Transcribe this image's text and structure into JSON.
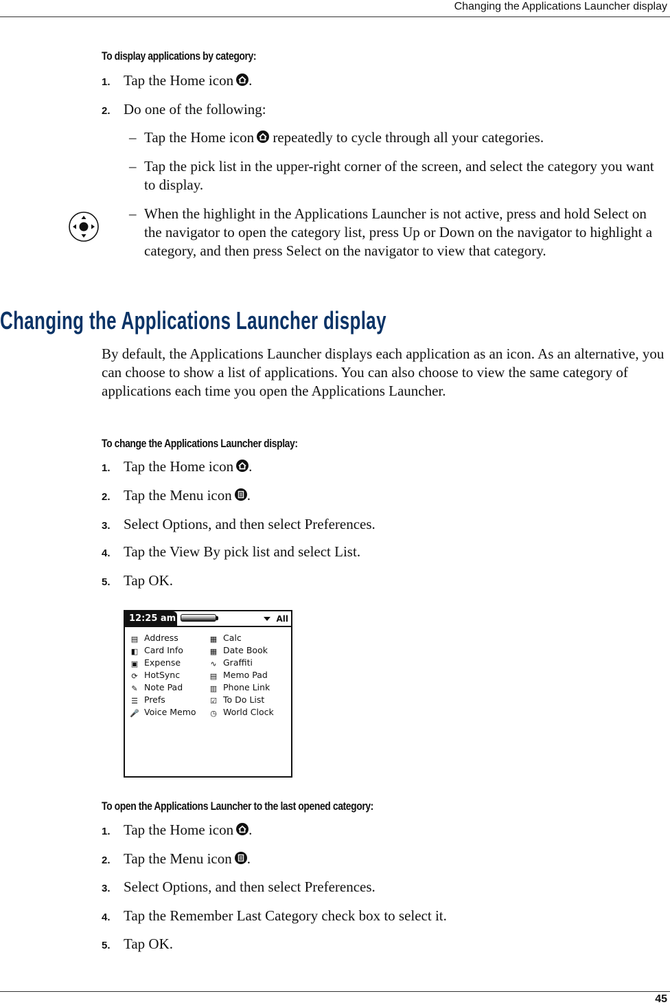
{
  "header": {
    "running_title": "Changing the Applications Launcher display"
  },
  "footer": {
    "page_number": "45"
  },
  "section1": {
    "heading": "To display applications by category:",
    "steps": [
      {
        "num": "1.",
        "text": "Tap the Home icon",
        "icon": "home-icon",
        "after": "."
      },
      {
        "num": "2.",
        "text": "Do one of the following:"
      }
    ],
    "options": [
      {
        "dash": "–",
        "text_before": "Tap the Home icon",
        "icon": "home-icon",
        "text_after": "repeatedly to cycle through all your categories."
      },
      {
        "dash": "–",
        "text": "Tap the pick list in the upper-right corner of the screen, and select the category you want to display."
      },
      {
        "dash": "–",
        "icon": "five-way-navigator-icon",
        "text": "When the highlight in the Applications Launcher is not active, press and hold Select on the navigator to open the category list, press Up or Down on the navigator to highlight a category, and then press Select on the navigator to view that category."
      }
    ]
  },
  "section2": {
    "title": "Changing the Applications Launcher display",
    "intro": "By default, the Applications Launcher displays each application as an icon. As an alternative, you can choose to show a list of applications. You can also choose to view the same category of applications each time you open the Applications Launcher.",
    "procedure1": {
      "heading": "To change the Applications Launcher display:",
      "steps": [
        {
          "num": "1.",
          "text": "Tap the Home icon",
          "icon": "home-icon",
          "after": "."
        },
        {
          "num": "2.",
          "text": "Tap the Menu icon",
          "icon": "menu-icon",
          "after": "."
        },
        {
          "num": "3.",
          "text": "Select Options, and then select Preferences."
        },
        {
          "num": "4.",
          "text": "Tap the View By pick list and select List."
        },
        {
          "num": "5.",
          "text": "Tap OK."
        }
      ]
    },
    "screen": {
      "time": "12:25 am",
      "category": "All",
      "apps_left": [
        {
          "name": "Address",
          "icon": "address-card-icon",
          "glyph": "▤"
        },
        {
          "name": "Card Info",
          "icon": "card-icon",
          "glyph": "◧"
        },
        {
          "name": "Expense",
          "icon": "expense-icon",
          "glyph": "▣"
        },
        {
          "name": "HotSync",
          "icon": "hotsync-icon",
          "glyph": "⟳"
        },
        {
          "name": "Note Pad",
          "icon": "notepad-icon",
          "glyph": "✎"
        },
        {
          "name": "Prefs",
          "icon": "prefs-icon",
          "glyph": "☰"
        },
        {
          "name": "Voice Memo",
          "icon": "microphone-icon",
          "glyph": "🎤"
        }
      ],
      "apps_right": [
        {
          "name": "Calc",
          "icon": "calculator-icon",
          "glyph": "▦"
        },
        {
          "name": "Date Book",
          "icon": "datebook-icon",
          "glyph": "▦"
        },
        {
          "name": "Graffiti",
          "icon": "graffiti-icon",
          "glyph": "∿"
        },
        {
          "name": "Memo Pad",
          "icon": "memo-icon",
          "glyph": "▤"
        },
        {
          "name": "Phone Link",
          "icon": "phone-link-icon",
          "glyph": "▥"
        },
        {
          "name": "To Do List",
          "icon": "checkbox-icon",
          "glyph": "☑"
        },
        {
          "name": "World Clock",
          "icon": "clock-icon",
          "glyph": "◷"
        }
      ]
    },
    "procedure2": {
      "heading": "To open the Applications Launcher to the last opened category:",
      "steps": [
        {
          "num": "1.",
          "text": "Tap the Home icon",
          "icon": "home-icon",
          "after": "."
        },
        {
          "num": "2.",
          "text": "Tap the Menu icon",
          "icon": "menu-icon",
          "after": "."
        },
        {
          "num": "3.",
          "text": "Select Options, and then select Preferences."
        },
        {
          "num": "4.",
          "text": "Tap the Remember Last Category check box to select it."
        },
        {
          "num": "5.",
          "text": "Tap OK."
        }
      ]
    }
  }
}
